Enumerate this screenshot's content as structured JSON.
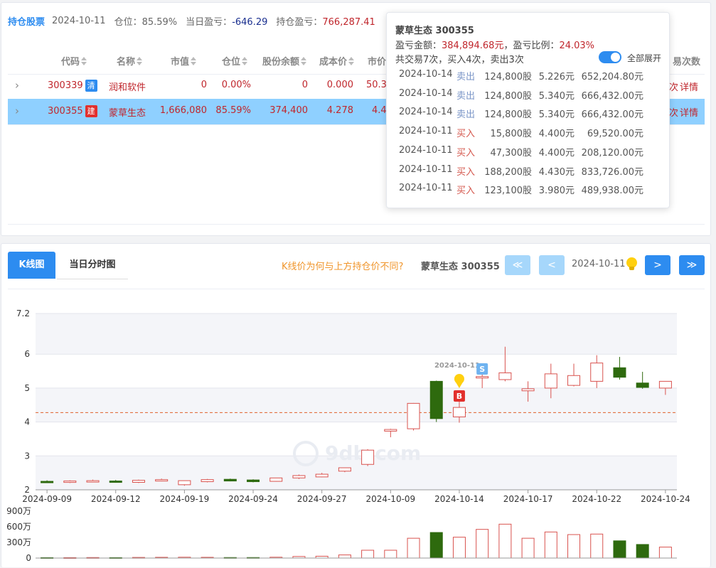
{
  "header": {
    "title": "持仓股票",
    "date": "2024-10-11",
    "position_label": "仓位：",
    "position_value": "85.59%",
    "daily_pl_label": "当日盈亏：",
    "daily_pl_value": "-646.29",
    "hold_pl_label": "持仓盈亏：",
    "hold_pl_value": "766,287.41"
  },
  "table": {
    "columns": [
      "代码",
      "名称",
      "市值",
      "仓位",
      "股份余额",
      "成本价",
      "市价",
      "易次数"
    ],
    "rows": [
      {
        "code": "300339",
        "tag": "清",
        "name": "润和软件",
        "market_value": "0",
        "position": "0.00%",
        "shares": "0",
        "cost": "0.000",
        "price": "50.3",
        "action1": "次",
        "detail": "详情"
      },
      {
        "code": "300355",
        "tag": "建",
        "name": "蒙草生态",
        "market_value": "1,666,080",
        "position": "85.59%",
        "shares": "374,400",
        "cost": "4.278",
        "price": "4.4",
        "action1": "次",
        "detail": "详情"
      }
    ]
  },
  "popover": {
    "title": "蒙草生态 300355",
    "pl_amount_label": "盈亏金额：",
    "pl_amount": "384,894.68元",
    "pl_ratio_label": "，盈亏比例：",
    "pl_ratio": "24.03%",
    "summary": "共交易7次，买入4次，卖出3次",
    "toggle_label": "全部展开",
    "trades": [
      {
        "date": "2024-10-14",
        "type": "卖出",
        "shares": "124,800股",
        "price": "5.226元",
        "amount": "652,204.80元"
      },
      {
        "date": "2024-10-14",
        "type": "卖出",
        "shares": "124,800股",
        "price": "5.340元",
        "amount": "666,432.00元"
      },
      {
        "date": "2024-10-14",
        "type": "卖出",
        "shares": "124,800股",
        "price": "5.340元",
        "amount": "666,432.00元"
      },
      {
        "date": "2024-10-11",
        "type": "买入",
        "shares": "15,800股",
        "price": "4.400元",
        "amount": "69,520.00元"
      },
      {
        "date": "2024-10-11",
        "type": "买入",
        "shares": "47,300股",
        "price": "4.400元",
        "amount": "208,120.00元"
      },
      {
        "date": "2024-10-11",
        "type": "买入",
        "shares": "188,200股",
        "price": "4.430元",
        "amount": "833,726.00元"
      },
      {
        "date": "2024-10-11",
        "type": "买入",
        "shares": "123,100股",
        "price": "3.980元",
        "amount": "489,938.00元"
      }
    ]
  },
  "kpanel": {
    "tab_kline": "K线图",
    "tab_intraday": "当日分时图",
    "question": "K线价为何与上方持仓价不同?",
    "stock": "蒙草生态 300355",
    "date": "2024-10-11",
    "btn_first": "≪",
    "btn_prev": "<",
    "btn_next": ">",
    "btn_last": "≫"
  },
  "chart_data": {
    "type": "candlestick",
    "y_ticks": [
      "7.2",
      "6",
      "5",
      "4",
      "3",
      "2"
    ],
    "y_range": [
      2,
      7.2
    ],
    "volume_ticks": [
      "900万",
      "600万",
      "300万",
      "0"
    ],
    "volume_range": [
      0,
      900
    ],
    "x_labels": [
      "2024-09-09",
      "2024-09-12",
      "2024-09-19",
      "2024-09-24",
      "2024-09-27",
      "2024-10-09",
      "2024-10-14",
      "2024-10-17",
      "2024-10-22",
      "2024-10-24"
    ],
    "x_label_index": [
      0,
      3,
      6,
      9,
      12,
      15,
      18,
      21,
      24,
      27
    ],
    "cost_line": 4.278,
    "candles": [
      {
        "o": 2.25,
        "h": 2.28,
        "l": 2.22,
        "c": 2.23,
        "v": 8
      },
      {
        "o": 2.22,
        "h": 2.28,
        "l": 2.2,
        "c": 2.26,
        "v": 8
      },
      {
        "o": 2.25,
        "h": 2.3,
        "l": 2.22,
        "c": 2.27,
        "v": 10
      },
      {
        "o": 2.26,
        "h": 2.29,
        "l": 2.22,
        "c": 2.24,
        "v": 8
      },
      {
        "o": 2.22,
        "h": 2.3,
        "l": 2.2,
        "c": 2.28,
        "v": 12
      },
      {
        "o": 2.27,
        "h": 2.33,
        "l": 2.25,
        "c": 2.3,
        "v": 14
      },
      {
        "o": 2.15,
        "h": 2.27,
        "l": 2.12,
        "c": 2.27,
        "v": 16
      },
      {
        "o": 2.24,
        "h": 2.32,
        "l": 2.22,
        "c": 2.3,
        "v": 14
      },
      {
        "o": 2.31,
        "h": 2.33,
        "l": 2.25,
        "c": 2.26,
        "v": 10
      },
      {
        "o": 2.29,
        "h": 2.31,
        "l": 2.22,
        "c": 2.24,
        "v": 10
      },
      {
        "o": 2.25,
        "h": 2.35,
        "l": 2.24,
        "c": 2.35,
        "v": 16
      },
      {
        "o": 2.35,
        "h": 2.45,
        "l": 2.32,
        "c": 2.42,
        "v": 30
      },
      {
        "o": 2.38,
        "h": 2.5,
        "l": 2.37,
        "c": 2.46,
        "v": 35
      },
      {
        "o": 2.55,
        "h": 2.65,
        "l": 2.52,
        "c": 2.65,
        "v": 60
      },
      {
        "o": 2.75,
        "h": 3.2,
        "l": 2.7,
        "c": 3.17,
        "v": 150
      },
      {
        "o": 3.73,
        "h": 3.8,
        "l": 3.55,
        "c": 3.78,
        "v": 150
      },
      {
        "o": 3.8,
        "h": 4.56,
        "l": 3.75,
        "c": 4.55,
        "v": 380
      },
      {
        "o": 5.2,
        "h": 5.22,
        "l": 4.0,
        "c": 4.1,
        "v": 490
      },
      {
        "o": 4.15,
        "h": 4.6,
        "l": 3.98,
        "c": 4.43,
        "v": 400
      },
      {
        "o": 5.3,
        "h": 5.52,
        "l": 5.0,
        "c": 5.34,
        "v": 550
      },
      {
        "o": 5.25,
        "h": 6.22,
        "l": 5.2,
        "c": 5.45,
        "v": 650
      },
      {
        "o": 4.92,
        "h": 5.2,
        "l": 4.6,
        "c": 4.98,
        "v": 380
      },
      {
        "o": 5.0,
        "h": 5.72,
        "l": 4.7,
        "c": 5.42,
        "v": 500
      },
      {
        "o": 5.08,
        "h": 5.72,
        "l": 5.05,
        "c": 5.37,
        "v": 450
      },
      {
        "o": 5.2,
        "h": 5.97,
        "l": 5.0,
        "c": 5.74,
        "v": 460
      },
      {
        "o": 5.6,
        "h": 5.92,
        "l": 5.25,
        "c": 5.32,
        "v": 330
      },
      {
        "o": 5.15,
        "h": 5.48,
        "l": 4.98,
        "c": 5.02,
        "v": 260
      },
      {
        "o": 5.0,
        "h": 5.2,
        "l": 4.8,
        "c": 5.2,
        "v": 210
      }
    ],
    "annotations": [
      {
        "text": "2024-10-11",
        "index": 18
      },
      {
        "text": "B",
        "index": 18
      },
      {
        "text": "S",
        "index": 19
      }
    ],
    "watermark": "9db.com",
    "colors": {
      "up": "#d9534f",
      "down": "#2e6a0e",
      "cost_line": "#e0602b",
      "buy_marker": "#e2302d",
      "sell_marker": "#6fb3f0",
      "pin": "#ffd00f"
    }
  }
}
